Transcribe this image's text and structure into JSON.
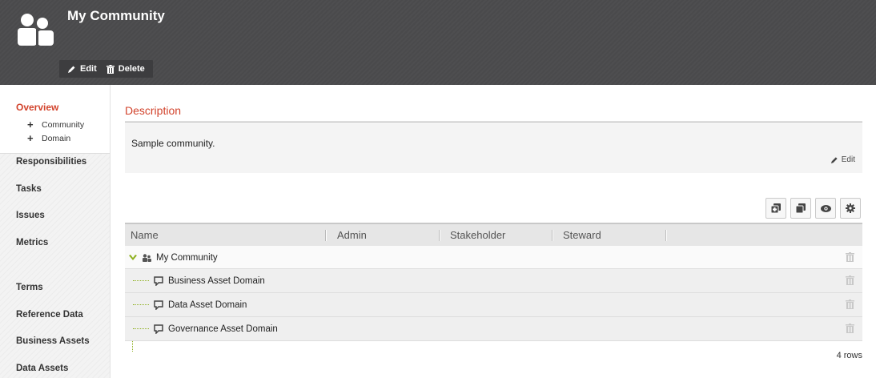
{
  "header": {
    "title": "My Community",
    "edit_label": "Edit",
    "delete_label": "Delete"
  },
  "sidebar": {
    "overview": "Overview",
    "sub_items": [
      "Community",
      "Domain"
    ],
    "items": [
      "Responsibilities",
      "Tasks",
      "Issues",
      "Metrics",
      "Terms",
      "Reference Data",
      "Business Assets",
      "Data Assets"
    ]
  },
  "description": {
    "title": "Description",
    "text": "Sample community.",
    "edit_label": "Edit"
  },
  "table": {
    "columns": [
      "Name",
      "Admin",
      "Stakeholder",
      "Steward"
    ],
    "rows": [
      {
        "name": "My Community",
        "type": "community"
      },
      {
        "name": "Business Asset Domain",
        "type": "domain"
      },
      {
        "name": "Data Asset Domain",
        "type": "domain"
      },
      {
        "name": "Governance Asset Domain",
        "type": "domain"
      }
    ],
    "row_count": "4 rows"
  },
  "toolbar_icons": [
    "add-community-icon",
    "add-domain-icon",
    "eye-icon",
    "gear-icon"
  ],
  "colors": {
    "accent": "#d2432c",
    "header_bg": "#4b4b4d",
    "tree_green": "#8eb01f"
  }
}
